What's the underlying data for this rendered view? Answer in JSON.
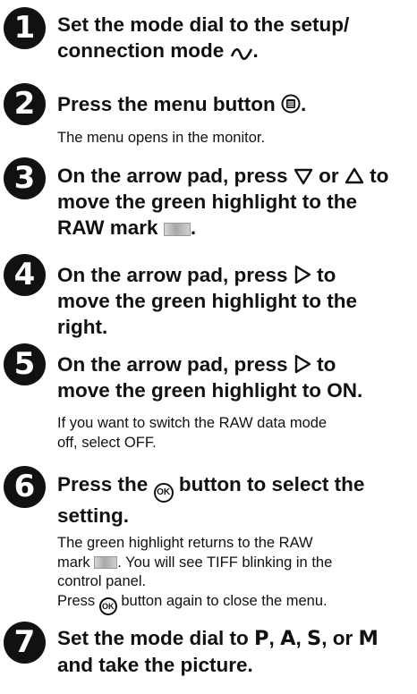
{
  "steps": [
    {
      "number": "1",
      "heading_part1": "Set the mode dial to the setup/",
      "heading_part2": "connection mode",
      "heading_end": "."
    },
    {
      "number": "2",
      "heading_part1": "Press the menu button",
      "heading_end": ".",
      "note": "The menu opens in the monitor."
    },
    {
      "number": "3",
      "heading_part1": "On the arrow pad, press",
      "heading_or": "or",
      "heading_part2": "to",
      "heading_line2": "move the green highlight to the",
      "heading_line3": "RAW mark",
      "heading_end": "."
    },
    {
      "number": "4",
      "heading_part1": "On the arrow pad, press",
      "heading_part2": "to",
      "heading_line2": "move the green highlight to the",
      "heading_line3": "right."
    },
    {
      "number": "5",
      "heading_part1": "On the arrow pad, press",
      "heading_part2": "to",
      "heading_line2": "move the green highlight to ON.",
      "note_line1": "If you want to switch the RAW data mode",
      "note_line2": "off, select OFF."
    },
    {
      "number": "6",
      "heading_part1": "Press the",
      "heading_part2": "button to select the",
      "heading_line2": "setting.",
      "note_line1": "The green highlight returns to the RAW",
      "note_line2a": "mark",
      "note_line2b": ". You will see TIFF blinking in the",
      "note_line3": "control panel.",
      "note_line4a": "Press",
      "note_line4b": "button again to close the menu."
    },
    {
      "number": "7",
      "heading_part1": "Set the mode dial to",
      "mode_p": "P",
      "mode_a": "A",
      "mode_s": "S",
      "mode_m": "M",
      "sep1": ",",
      "sep2": ",",
      "sep3": ", or",
      "heading_line2": "and take the picture."
    }
  ],
  "icons": {
    "setup_mode": "wave-icon",
    "menu_button": "menu-button-icon",
    "arrow_down": "triangle-down-icon",
    "arrow_up": "triangle-up-icon",
    "arrow_right": "triangle-right-icon",
    "ok_button": "ok-button-icon",
    "ok_label": "OK",
    "raw_mark": "raw-mark-icon"
  }
}
